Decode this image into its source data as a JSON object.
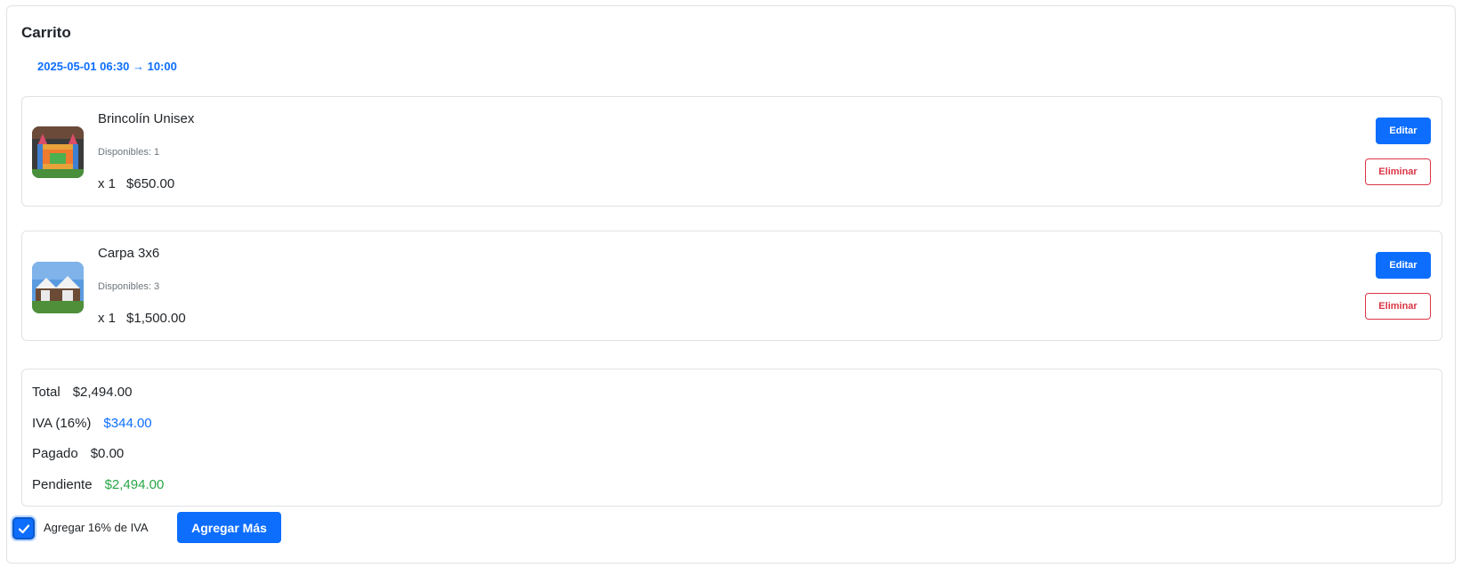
{
  "cart": {
    "title": "Carrito",
    "date_range": "2025-05-01 06:30 → 10:00"
  },
  "items": [
    {
      "name": "Brincolín Unisex",
      "availability": "Disponibles: 1",
      "quantity": "x 1",
      "price": "$650.00",
      "edit_label": "Editar",
      "delete_label": "Eliminar",
      "thumbnail_icon": "bounce-house-image"
    },
    {
      "name": "Carpa 3x6",
      "availability": "Disponibles: 3",
      "quantity": "x 1",
      "price": "$1,500.00",
      "edit_label": "Editar",
      "delete_label": "Eliminar",
      "thumbnail_icon": "tent-image"
    }
  ],
  "summary": {
    "total_label": "Total",
    "total_value": "$2,494.00",
    "iva_label": "IVA (16%)",
    "iva_value": "$344.00",
    "paid_label": "Pagado",
    "paid_value": "$0.00",
    "pending_label": "Pendiente",
    "pending_value": "$2,494.00"
  },
  "footer": {
    "iva_checkbox_label": "Agregar 16% de IVA",
    "iva_checkbox_checked": true,
    "add_more_label": "Agregar Más"
  },
  "colors": {
    "primary": "#0d6efd",
    "danger": "#dc3545",
    "success": "#28a745"
  }
}
